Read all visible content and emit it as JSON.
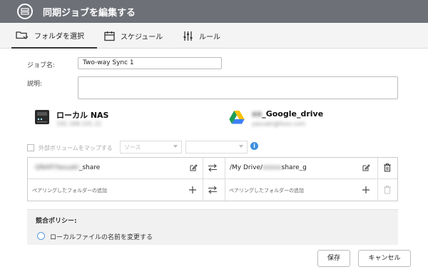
{
  "window": {
    "title": "同期ジョブを編集する"
  },
  "tabs": [
    {
      "label": "フォルダを選択"
    },
    {
      "label": "スケジュール"
    },
    {
      "label": "ルール"
    }
  ],
  "form": {
    "job_name_label": "ジョブ名:",
    "job_name_value": "Two-way Sync 1",
    "description_label": "説明:",
    "description_value": ""
  },
  "local": {
    "name": "ローカル NAS",
    "sub": "192.168.101.21"
  },
  "remote": {
    "name_prefix": "xx",
    "name": "_Google_drive",
    "sub": "yasuaki@fxxx.com"
  },
  "mapping": {
    "checkbox_label": "外部ボリュームをマップする",
    "source_placeholder": "ソース",
    "second_placeholder": ""
  },
  "pairs": {
    "row1": {
      "local_prefix": "QNAP/Yasuaki",
      "local_suffix": "share",
      "remote_prefix": "/My Drive/",
      "remote_blur": "xxxxx",
      "remote_suffix": "share_g"
    },
    "add_local": "ペアリングしたフォルダーの追加",
    "add_remote": "ペアリングしたフォルダーの追加"
  },
  "policy": {
    "header": "競合ポリシー:",
    "option1": "ローカルファイルの名前を変更する"
  },
  "footer": {
    "save": "保存",
    "cancel": "キャンセル"
  },
  "colors": {
    "titlebar": "#6e7078",
    "accent": "#3b8fe0"
  }
}
